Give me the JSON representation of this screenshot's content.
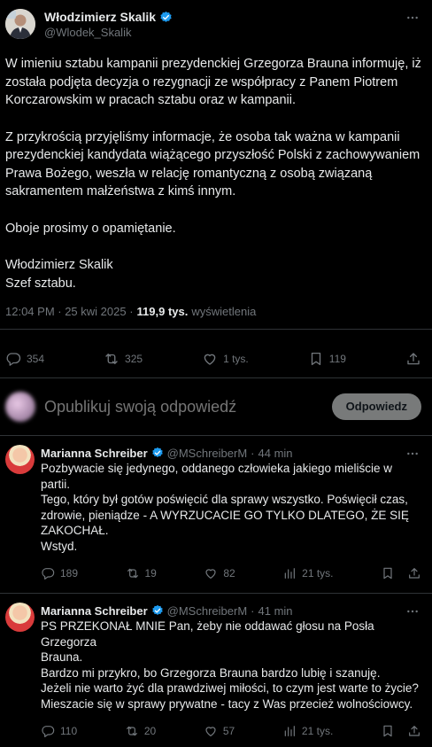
{
  "post": {
    "author_name": "Włodzimierz Skalik",
    "author_handle": "@Wlodek_Skalik",
    "paragraphs": [
      "W imieniu sztabu kampanii prezydenckiej Grzegorza Brauna informuję, iż została podjęta decyzja o rezygnacji ze współpracy z Panem Piotrem Korczarowskim w pracach sztabu oraz w kampanii.",
      "Z przykrością przyjęliśmy informacje, że osoba tak ważna w kampanii prezydenckiej kandydata wiążącego przyszłość Polski z zachowywaniem Prawa Bożego, weszła w relację romantyczną z osobą związaną sakramentem małżeństwa z kimś innym.",
      "Oboje prosimy o opamiętanie."
    ],
    "signature_name": "Włodzimierz Skalik",
    "signature_title": "Szef sztabu.",
    "timestamp": "12:04 PM · 25 kwi 2025 ·",
    "views_count": "119,9 tys.",
    "views_label": "wyświetlenia",
    "replies": "354",
    "reposts": "325",
    "likes": "1 tys.",
    "bookmarks": "119"
  },
  "composer": {
    "placeholder": "Opublikuj swoją odpowiedź",
    "button_label": "Odpowiedz"
  },
  "replies": [
    {
      "name": "Marianna Schreiber",
      "handle": "@MSchreiberM",
      "time": "44 min",
      "text_lines": [
        "Pozbywacie się jedynego, oddanego człowieka jakiego mieliście w partii.",
        "Tego, który był gotów poświęcić dla sprawy wszystko. Poświęcił czas,",
        "zdrowie, pieniądze - A WYRZUCACIE GO TYLKO DLATEGO, ŻE SIĘ",
        "ZAKOCHAŁ.",
        "Wstyd."
      ],
      "replies": "189",
      "reposts": "19",
      "likes": "82",
      "views": "21 tys."
    },
    {
      "name": "Marianna Schreiber",
      "handle": "@MSchreiberM",
      "time": "41 min",
      "text_lines": [
        "PS PRZEKONAŁ MNIE Pan, żeby nie oddawać głosu na Posła Grzegorza",
        "Brauna.",
        "Bardzo mi przykro, bo Grzegorza Brauna bardzo lubię i szanuję.",
        "Jeżeli nie warto żyć dla prawdziwej miłości, to czym jest warte to życie?",
        "Mieszacie się w sprawy prywatne - tacy z Was przecież wolnościowcy."
      ],
      "replies": "110",
      "reposts": "20",
      "likes": "57",
      "views": "21 tys."
    }
  ],
  "colors": {
    "background": "#000000",
    "text": "#e7e9ea",
    "muted": "#71767b",
    "verified": "#1d9bf0",
    "divider": "#2f3336",
    "reply_button": "#787a7a"
  },
  "icons": [
    "verified-badge-icon",
    "more-icon",
    "reply-icon",
    "repost-icon",
    "like-icon",
    "bookmark-icon",
    "share-icon",
    "views-icon"
  ]
}
